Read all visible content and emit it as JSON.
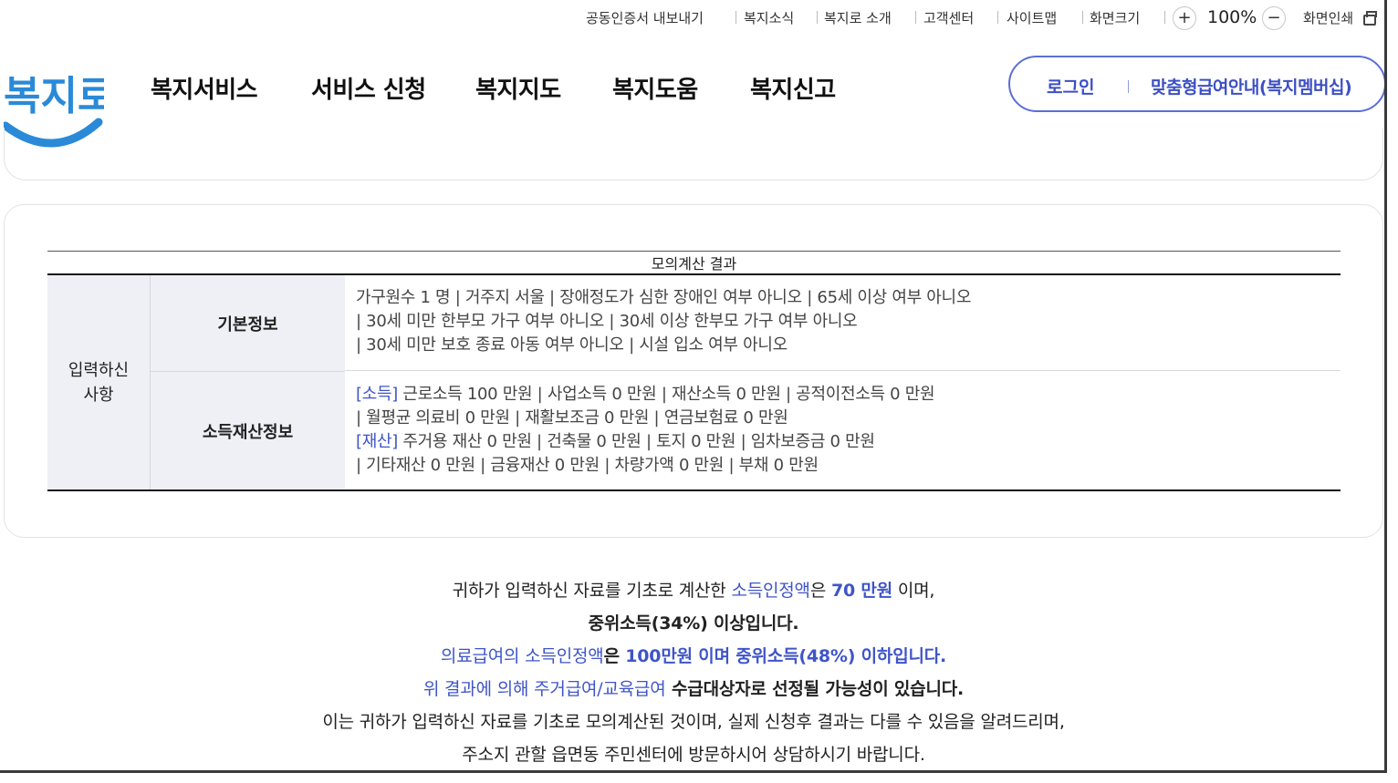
{
  "utility": {
    "cert_export": "공동인증서 내보내기",
    "news": "복지소식",
    "about": "복지로 소개",
    "customer": "고객센터",
    "sitemap": "사이트맵",
    "screen_size": "화면크기",
    "zoom_in": "+",
    "zoom_level": "100%",
    "zoom_out": "−",
    "print": "화면인쇄"
  },
  "logo": {
    "text": "복지로",
    "color": "#2a8ad8"
  },
  "nav": [
    "복지서비스",
    "서비스 신청",
    "복지지도",
    "복지도움",
    "복지신고"
  ],
  "account": {
    "login": "로그인",
    "membership": "맞춤형급여안내(복지멤버십)"
  },
  "table": {
    "caption": "모의계산 결과",
    "group_header": "입력하신 사항",
    "basic": {
      "header": "기본정보",
      "lines": [
        "가구원수 1 명 | 거주지 서울 | 장애정도가 심한 장애인 여부 아니오 | 65세 이상 여부 아니오",
        "| 30세 미만 한부모 가구 여부 아니오 | 30세 이상 한부모 가구 여부 아니오",
        "| 30세 미만 보호 종료 아동 여부 아니오 | 시설 입소 여부 아니오"
      ]
    },
    "income": {
      "header": "소득재산정보",
      "income_tag": "[소득]",
      "income_line1": " 근로소득 100 만원 | 사업소득 0 만원 | 재산소득 0 만원 | 공적이전소득 0 만원",
      "income_line2": "| 월평균 의료비 0 만원 | 재활보조금 0 만원 | 연금보험료 0 만원",
      "asset_tag": "[재산]",
      "asset_line1": " 주거용 재산 0 만원 | 건축물 0 만원 | 토지 0 만원 | 임차보증금 0 만원",
      "asset_line2": "| 기타재산 0 만원 | 금융재산 0 만원 | 차량가액 0 만원 | 부채 0 만원"
    }
  },
  "result": {
    "l1_a": "귀하가 입력하신 자료를 기초로 계산한 ",
    "l1_b": "소득인정액",
    "l1_c": "은 ",
    "l1_d": "70 만원",
    "l1_e": " 이며,",
    "l2": "중위소득(34%) 이상입니다.",
    "l3_a": "의료급여의 소득인정액",
    "l3_b": "은 ",
    "l3_c": "100만원 이며 중위소득(48%) 이하입니다.",
    "l4_a": "위 결과에 의해 주거급여/교육급여",
    "l4_b": " 수급대상자로 선정될 가능성이 있습니다.",
    "l5": "이는 귀하가 입력하신 자료를 기초로 모의계산된 것이며, 실제 신청후 결과는 다를 수 있음을 알려드리며,",
    "l6": "주소지 관할 읍면동 주민센터에 방문하시어 상담하시기 바랍니다."
  }
}
